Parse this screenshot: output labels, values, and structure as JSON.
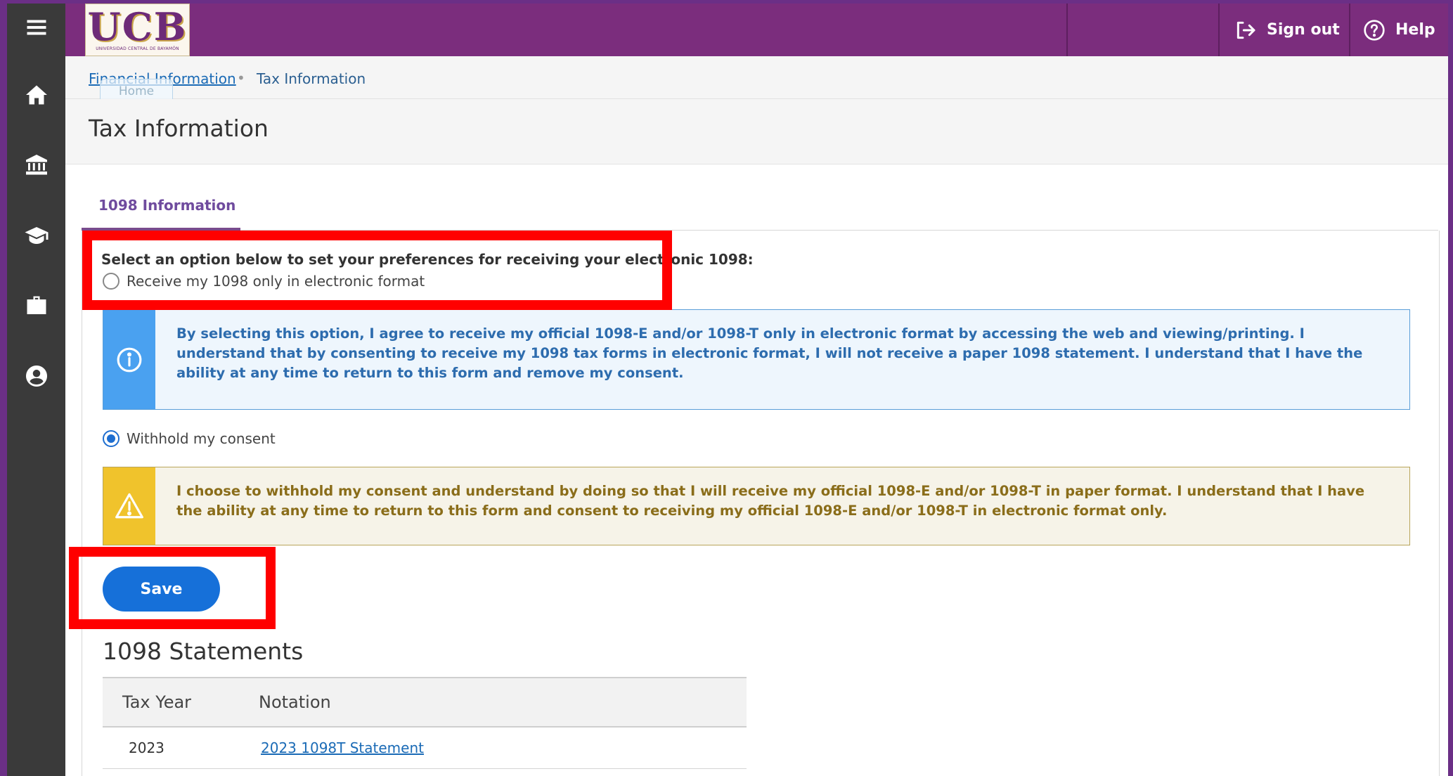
{
  "header": {
    "logo_text": "UCB",
    "logo_subtitle": "UNIVERSIDAD CENTRAL DE BAYAMÓN",
    "sign_out_label": "Sign out",
    "help_label": "Help"
  },
  "sidenav": {
    "items": [
      "menu-icon",
      "home-icon",
      "bank-icon",
      "graduation-cap-icon",
      "briefcase-icon",
      "user-circle-icon"
    ]
  },
  "breadcrumb": {
    "parent": "Financial Information",
    "current": "Tax Information",
    "tooltip": "Home"
  },
  "page": {
    "title": "Tax Information"
  },
  "tabs": [
    {
      "label": "1098 Information",
      "active": true
    }
  ],
  "form": {
    "prompt": "Select an option below to set your preferences for receiving your electronic 1098:",
    "option_electronic": "Receive my 1098 only in electronic format",
    "option_electronic_checked": false,
    "electronic_notice": "By selecting this option, I agree to receive my official 1098-E and/or 1098-T only in electronic format by accessing the web and viewing/printing. I understand that by consenting to receive my 1098 tax forms in electronic format, I will not receive a paper 1098 statement. I understand that I have the ability at any time to return to this form and remove my consent.",
    "option_withhold": "Withhold my consent",
    "option_withhold_checked": true,
    "withhold_notice": "I choose to withhold my consent and understand by doing so that I will receive my official 1098-E and/or 1098-T in paper format. I understand that I have the ability at any time to return to this form and consent to receiving my official 1098-E and/or 1098-T in electronic format only.",
    "save_label": "Save"
  },
  "statements": {
    "title": "1098 Statements",
    "columns": [
      "Tax Year",
      "Notation"
    ],
    "rows": [
      {
        "year": "2023",
        "notation": "2023 1098T Statement"
      }
    ]
  },
  "colors": {
    "header_purple": "#7b2d7d",
    "sidenav_dark": "#3a3a3a",
    "primary_blue": "#1670d9",
    "highlight_red": "#ff0000"
  }
}
